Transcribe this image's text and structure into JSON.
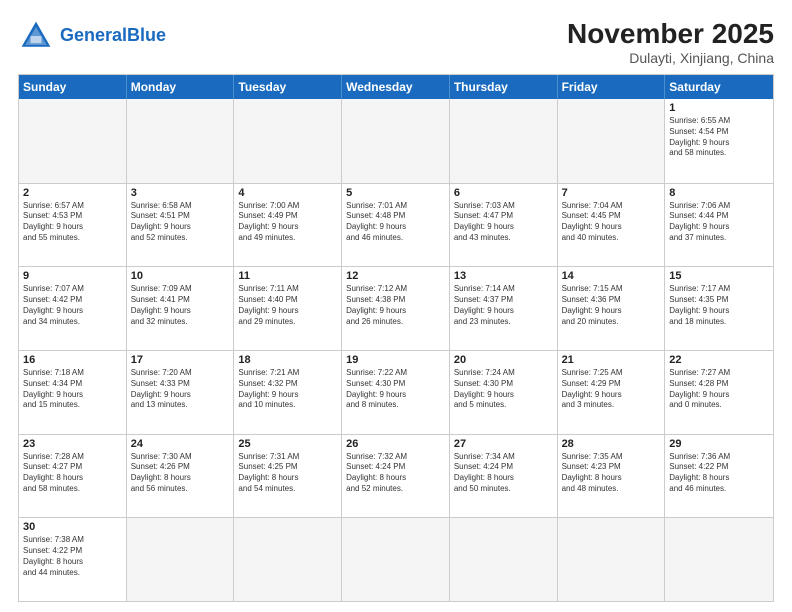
{
  "logo": {
    "text_general": "General",
    "text_blue": "Blue"
  },
  "title": "November 2025",
  "location": "Dulayti, Xinjiang, China",
  "days_of_week": [
    "Sunday",
    "Monday",
    "Tuesday",
    "Wednesday",
    "Thursday",
    "Friday",
    "Saturday"
  ],
  "weeks": [
    [
      {
        "day": "",
        "info": ""
      },
      {
        "day": "",
        "info": ""
      },
      {
        "day": "",
        "info": ""
      },
      {
        "day": "",
        "info": ""
      },
      {
        "day": "",
        "info": ""
      },
      {
        "day": "",
        "info": ""
      },
      {
        "day": "1",
        "info": "Sunrise: 6:55 AM\nSunset: 4:54 PM\nDaylight: 9 hours\nand 58 minutes."
      }
    ],
    [
      {
        "day": "2",
        "info": "Sunrise: 6:57 AM\nSunset: 4:53 PM\nDaylight: 9 hours\nand 55 minutes."
      },
      {
        "day": "3",
        "info": "Sunrise: 6:58 AM\nSunset: 4:51 PM\nDaylight: 9 hours\nand 52 minutes."
      },
      {
        "day": "4",
        "info": "Sunrise: 7:00 AM\nSunset: 4:49 PM\nDaylight: 9 hours\nand 49 minutes."
      },
      {
        "day": "5",
        "info": "Sunrise: 7:01 AM\nSunset: 4:48 PM\nDaylight: 9 hours\nand 46 minutes."
      },
      {
        "day": "6",
        "info": "Sunrise: 7:03 AM\nSunset: 4:47 PM\nDaylight: 9 hours\nand 43 minutes."
      },
      {
        "day": "7",
        "info": "Sunrise: 7:04 AM\nSunset: 4:45 PM\nDaylight: 9 hours\nand 40 minutes."
      },
      {
        "day": "8",
        "info": "Sunrise: 7:06 AM\nSunset: 4:44 PM\nDaylight: 9 hours\nand 37 minutes."
      }
    ],
    [
      {
        "day": "9",
        "info": "Sunrise: 7:07 AM\nSunset: 4:42 PM\nDaylight: 9 hours\nand 34 minutes."
      },
      {
        "day": "10",
        "info": "Sunrise: 7:09 AM\nSunset: 4:41 PM\nDaylight: 9 hours\nand 32 minutes."
      },
      {
        "day": "11",
        "info": "Sunrise: 7:11 AM\nSunset: 4:40 PM\nDaylight: 9 hours\nand 29 minutes."
      },
      {
        "day": "12",
        "info": "Sunrise: 7:12 AM\nSunset: 4:38 PM\nDaylight: 9 hours\nand 26 minutes."
      },
      {
        "day": "13",
        "info": "Sunrise: 7:14 AM\nSunset: 4:37 PM\nDaylight: 9 hours\nand 23 minutes."
      },
      {
        "day": "14",
        "info": "Sunrise: 7:15 AM\nSunset: 4:36 PM\nDaylight: 9 hours\nand 20 minutes."
      },
      {
        "day": "15",
        "info": "Sunrise: 7:17 AM\nSunset: 4:35 PM\nDaylight: 9 hours\nand 18 minutes."
      }
    ],
    [
      {
        "day": "16",
        "info": "Sunrise: 7:18 AM\nSunset: 4:34 PM\nDaylight: 9 hours\nand 15 minutes."
      },
      {
        "day": "17",
        "info": "Sunrise: 7:20 AM\nSunset: 4:33 PM\nDaylight: 9 hours\nand 13 minutes."
      },
      {
        "day": "18",
        "info": "Sunrise: 7:21 AM\nSunset: 4:32 PM\nDaylight: 9 hours\nand 10 minutes."
      },
      {
        "day": "19",
        "info": "Sunrise: 7:22 AM\nSunset: 4:30 PM\nDaylight: 9 hours\nand 8 minutes."
      },
      {
        "day": "20",
        "info": "Sunrise: 7:24 AM\nSunset: 4:30 PM\nDaylight: 9 hours\nand 5 minutes."
      },
      {
        "day": "21",
        "info": "Sunrise: 7:25 AM\nSunset: 4:29 PM\nDaylight: 9 hours\nand 3 minutes."
      },
      {
        "day": "22",
        "info": "Sunrise: 7:27 AM\nSunset: 4:28 PM\nDaylight: 9 hours\nand 0 minutes."
      }
    ],
    [
      {
        "day": "23",
        "info": "Sunrise: 7:28 AM\nSunset: 4:27 PM\nDaylight: 8 hours\nand 58 minutes."
      },
      {
        "day": "24",
        "info": "Sunrise: 7:30 AM\nSunset: 4:26 PM\nDaylight: 8 hours\nand 56 minutes."
      },
      {
        "day": "25",
        "info": "Sunrise: 7:31 AM\nSunset: 4:25 PM\nDaylight: 8 hours\nand 54 minutes."
      },
      {
        "day": "26",
        "info": "Sunrise: 7:32 AM\nSunset: 4:24 PM\nDaylight: 8 hours\nand 52 minutes."
      },
      {
        "day": "27",
        "info": "Sunrise: 7:34 AM\nSunset: 4:24 PM\nDaylight: 8 hours\nand 50 minutes."
      },
      {
        "day": "28",
        "info": "Sunrise: 7:35 AM\nSunset: 4:23 PM\nDaylight: 8 hours\nand 48 minutes."
      },
      {
        "day": "29",
        "info": "Sunrise: 7:36 AM\nSunset: 4:22 PM\nDaylight: 8 hours\nand 46 minutes."
      }
    ],
    [
      {
        "day": "30",
        "info": "Sunrise: 7:38 AM\nSunset: 4:22 PM\nDaylight: 8 hours\nand 44 minutes."
      },
      {
        "day": "",
        "info": ""
      },
      {
        "day": "",
        "info": ""
      },
      {
        "day": "",
        "info": ""
      },
      {
        "day": "",
        "info": ""
      },
      {
        "day": "",
        "info": ""
      },
      {
        "day": "",
        "info": ""
      }
    ]
  ]
}
